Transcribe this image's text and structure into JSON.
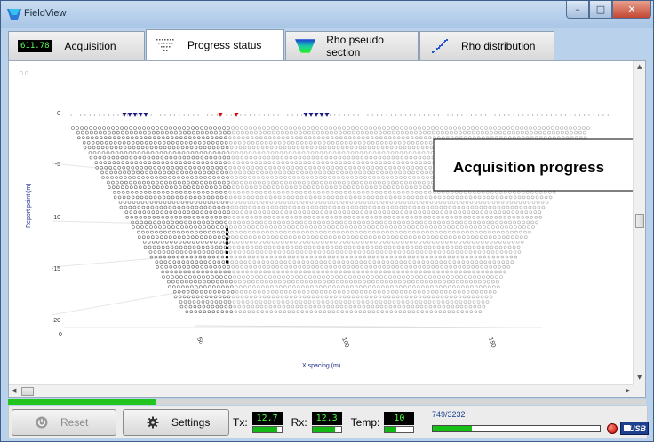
{
  "window": {
    "title": "FieldView",
    "min_glyph": "–",
    "max_glyph": "□",
    "close_glyph": "✕"
  },
  "tabs": [
    {
      "counter": "611.78",
      "label": "Acquisition",
      "active": false,
      "icon": "counter-display"
    },
    {
      "label": "Progress status",
      "active": true,
      "icon": "triangle-grid-icon"
    },
    {
      "label": "Rho pseudo section",
      "active": false,
      "icon": "rho-section-icon"
    },
    {
      "label": "Rho distribution",
      "active": false,
      "icon": "rho-distribution-icon"
    }
  ],
  "plot": {
    "corner_value": "0.0",
    "overlay_text": "Acquisition progress",
    "x_axis_label": "X spacing (m)",
    "y_axis_label": "Report point (m)",
    "y_ticks": [
      "0",
      "-5",
      "-10",
      "-15",
      "-20"
    ],
    "x_ticks": [
      "0",
      "50",
      "100",
      "150"
    ],
    "colors": {
      "done": "#666666",
      "pending": "#aaaaaa",
      "electrode": "#1a1a80",
      "active_electrode": "#e00000",
      "axis_label": "#1a2a8a"
    }
  },
  "footer": {
    "reset_label": "Reset",
    "settings_label": "Settings",
    "tx_label": "Tx:",
    "tx_value": "12.7",
    "tx_level": 0.85,
    "rx_label": "Rx:",
    "rx_value": "12.3",
    "rx_level": 0.8,
    "temp_label": "Temp:",
    "temp_value": "10",
    "temp_level": 0.4,
    "measure_count": "749/3232",
    "measure_progress": 0.232,
    "usb_label": "USB",
    "strip_progress": 0.232
  }
}
